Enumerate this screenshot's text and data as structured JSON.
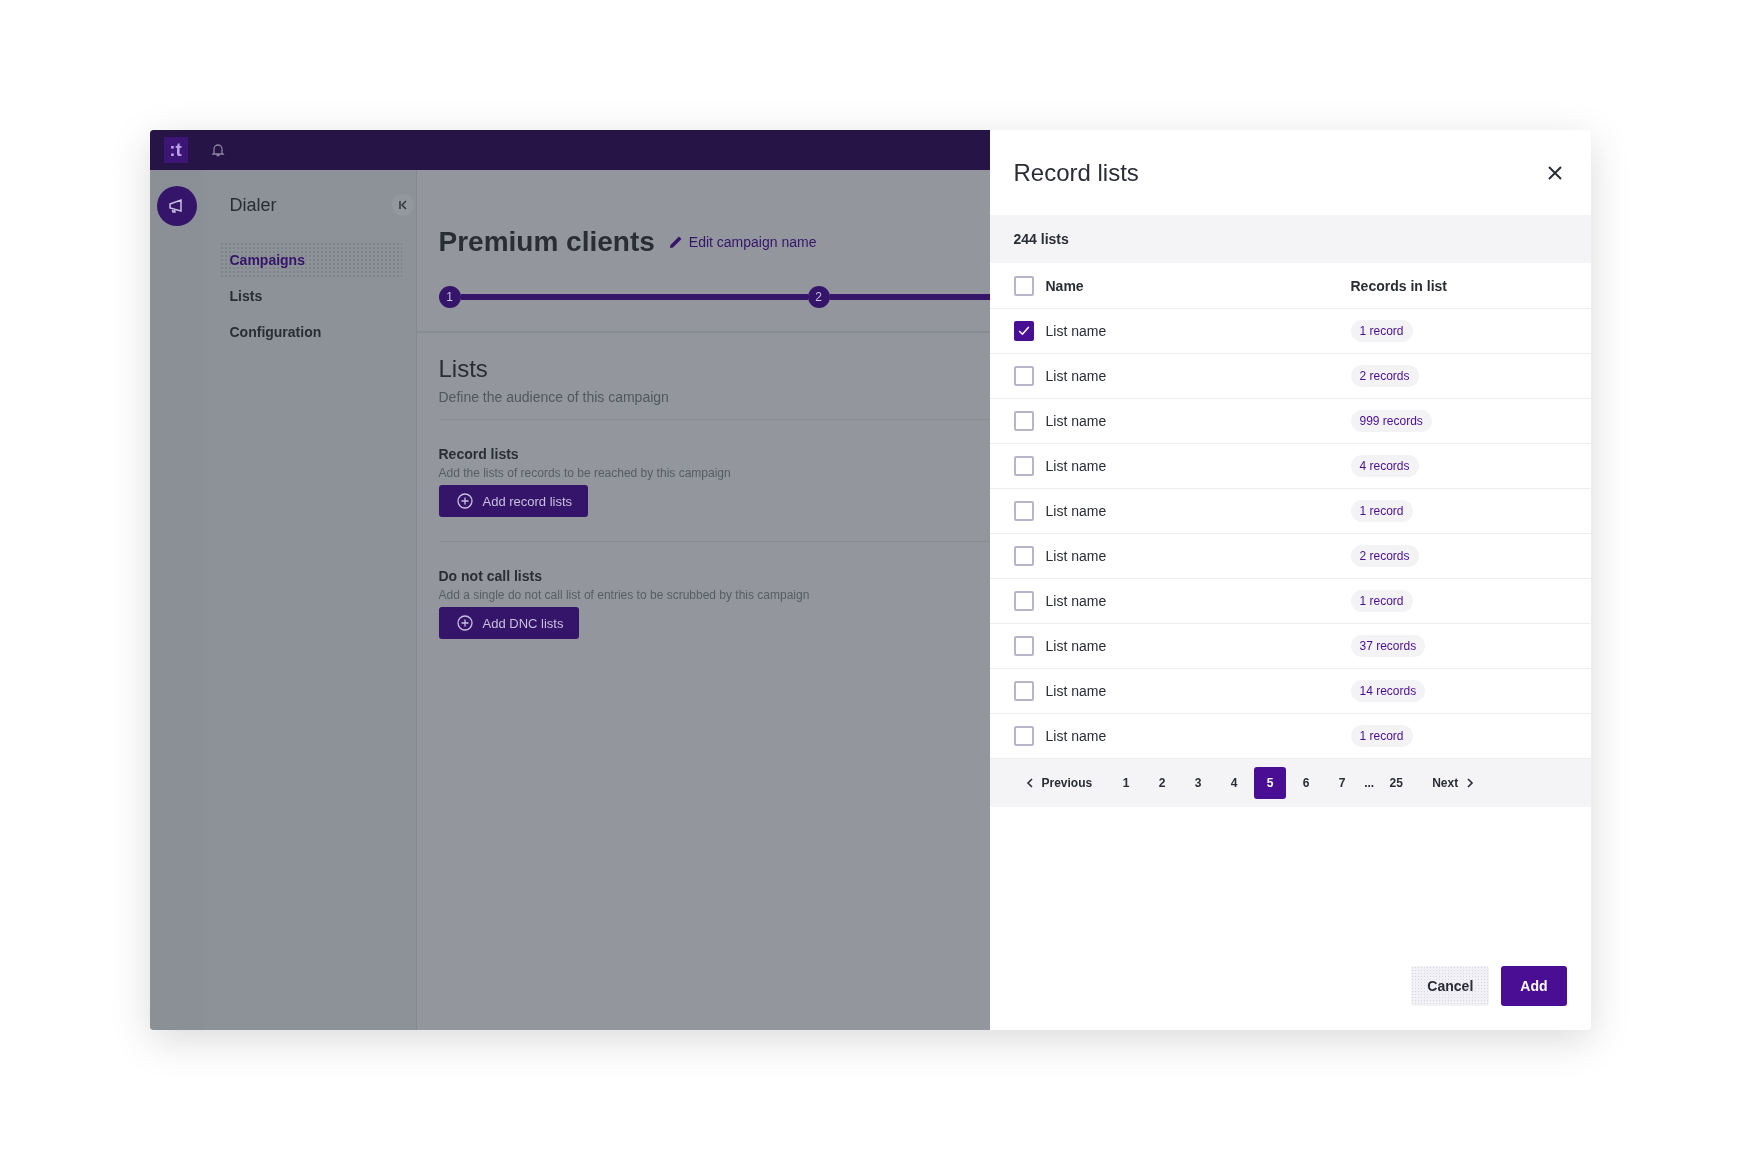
{
  "topbar": {
    "logo": ":t"
  },
  "sidebar": {
    "app_title": "Dialer",
    "items": [
      {
        "label": "Campaigns",
        "selected": true
      },
      {
        "label": "Lists",
        "selected": false
      },
      {
        "label": "Configuration",
        "selected": false
      }
    ]
  },
  "main": {
    "title": "Premium clients",
    "edit_link": "Edit campaign name",
    "steps": [
      {
        "label": "1"
      },
      {
        "label": "2"
      }
    ],
    "section_title": "Lists",
    "section_subtitle": "Define the audience of this campaign",
    "groups": [
      {
        "title": "Record lists",
        "description": "Add the lists of records to be reached by this campaign",
        "button": "Add record lists"
      },
      {
        "title": "Do not call lists",
        "description": "Add a single do not call list of entries to be scrubbed by this campaign",
        "button": "Add DNC lists"
      }
    ]
  },
  "drawer": {
    "title": "Record lists",
    "count": "244 lists",
    "columns": [
      "Name",
      "Records in list"
    ],
    "select_all_checked": false,
    "rows": [
      {
        "name": "List name",
        "records": "1 record",
        "checked": true
      },
      {
        "name": "List name",
        "records": "2 records",
        "checked": false
      },
      {
        "name": "List name",
        "records": "999 records",
        "checked": false
      },
      {
        "name": "List name",
        "records": "4 records",
        "checked": false
      },
      {
        "name": "List name",
        "records": "1 record",
        "checked": false
      },
      {
        "name": "List name",
        "records": "2 records",
        "checked": false
      },
      {
        "name": "List name",
        "records": "1 record",
        "checked": false
      },
      {
        "name": "List name",
        "records": "37 records",
        "checked": false
      },
      {
        "name": "List name",
        "records": "14 records",
        "checked": false
      },
      {
        "name": "List name",
        "records": "1 record",
        "checked": false
      }
    ],
    "pagination": [
      {
        "kind": "previous",
        "label": "Previous"
      },
      {
        "kind": "page",
        "label": "1",
        "selected": false
      },
      {
        "kind": "page",
        "label": "2",
        "selected": false
      },
      {
        "kind": "page",
        "label": "3",
        "selected": false
      },
      {
        "kind": "page",
        "label": "4",
        "selected": false
      },
      {
        "kind": "page",
        "label": "5",
        "selected": true
      },
      {
        "kind": "page",
        "label": "6",
        "selected": false
      },
      {
        "kind": "page",
        "label": "7",
        "selected": false
      },
      {
        "kind": "ellipsis",
        "label": "..."
      },
      {
        "kind": "page",
        "label": "25",
        "selected": false
      },
      {
        "kind": "next",
        "label": "Next"
      }
    ],
    "buttons": {
      "cancel": "Cancel",
      "confirm": "Add"
    }
  }
}
